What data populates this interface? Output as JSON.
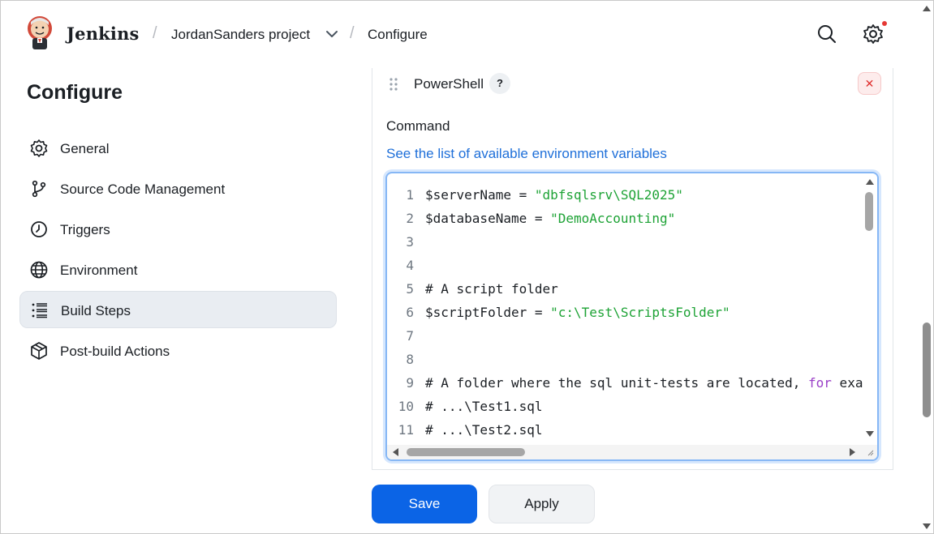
{
  "header": {
    "brand": "Jenkins",
    "breadcrumbs": [
      {
        "label": "JordanSanders project"
      },
      {
        "label": "Configure"
      }
    ],
    "separator": "/"
  },
  "sidebar": {
    "title": "Configure",
    "active_item": "Build Steps",
    "items": [
      {
        "label": "General",
        "icon": "gear-icon"
      },
      {
        "label": "Source Code Management",
        "icon": "branch-icon"
      },
      {
        "label": "Triggers",
        "icon": "clock-icon"
      },
      {
        "label": "Environment",
        "icon": "globe-icon"
      },
      {
        "label": "Build Steps",
        "icon": "list-icon"
      },
      {
        "label": "Post-build Actions",
        "icon": "package-icon"
      }
    ]
  },
  "step": {
    "title": "PowerShell",
    "help": "?",
    "close": "✕",
    "command_label": "Command",
    "env_link_prefix": "See",
    "env_link": "the list of available environment variables"
  },
  "editor": {
    "lines": [
      {
        "n": "1",
        "code": "$serverName = ",
        "str": "\"dbfsqlsrv\\SQL2025\""
      },
      {
        "n": "2",
        "code": "$databaseName = ",
        "str": "\"DemoAccounting\""
      },
      {
        "n": "3",
        "code": ""
      },
      {
        "n": "4",
        "code": ""
      },
      {
        "n": "5",
        "code": "# A script folder"
      },
      {
        "n": "6",
        "code": "$scriptFolder = ",
        "str": "\"c:\\Test\\ScriptsFolder\""
      },
      {
        "n": "7",
        "code": ""
      },
      {
        "n": "8",
        "code": ""
      },
      {
        "n": "9",
        "code": "# A folder where the sql unit-tests are located, ",
        "kw": "for",
        "tail": " exa"
      },
      {
        "n": "10",
        "code": "# ...\\Test1.sql"
      },
      {
        "n": "11",
        "code": "# ...\\Test2.sql"
      }
    ]
  },
  "actions": {
    "save": "Save",
    "apply": "Apply"
  },
  "colors": {
    "primary": "#0b64e6",
    "link": "#1e6fd9",
    "string": "#1ea336",
    "keyword": "#9a3fc7",
    "active_bg": "#e9edf2"
  }
}
